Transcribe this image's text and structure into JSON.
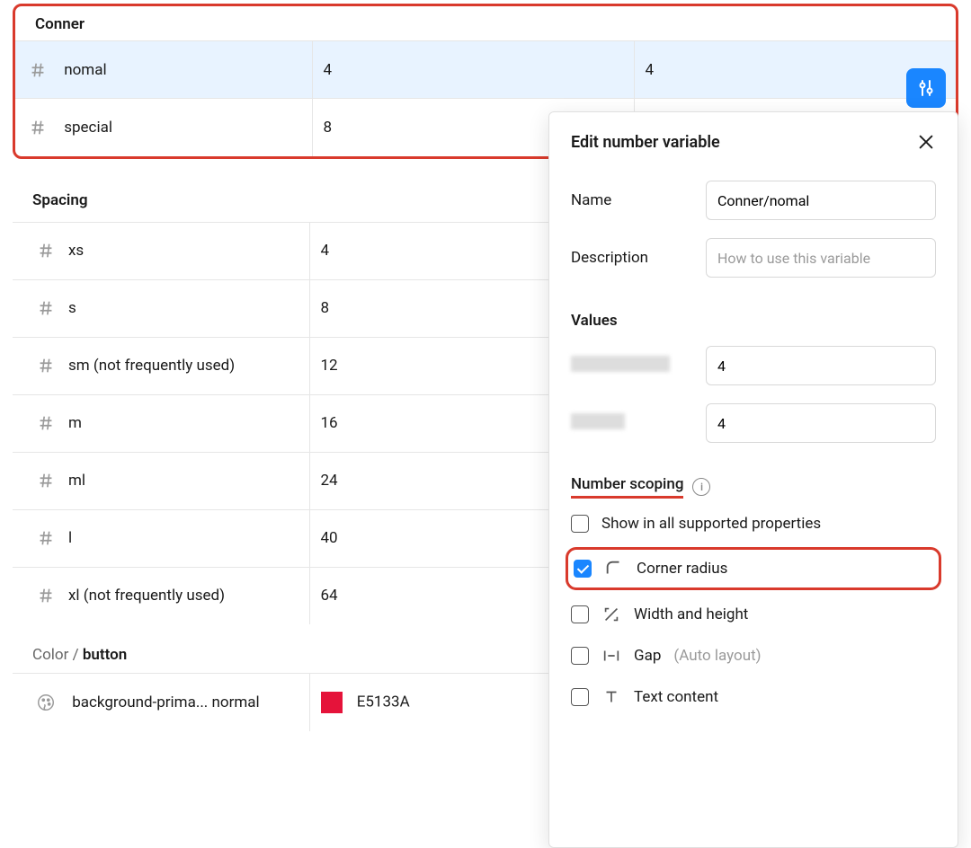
{
  "corner": {
    "heading": "Conner",
    "rows": [
      {
        "name": "nomal",
        "value1": "4",
        "value2": "4",
        "selected": true
      },
      {
        "name": "special",
        "value1": "8",
        "value2": ""
      }
    ]
  },
  "spacing": {
    "heading": "Spacing",
    "rows": [
      {
        "name": "xs",
        "value": "4"
      },
      {
        "name": "s",
        "value": "8"
      },
      {
        "name": "sm (not frequently used)",
        "value": "12"
      },
      {
        "name": "m",
        "value": "16"
      },
      {
        "name": "ml",
        "value": "24"
      },
      {
        "name": "l",
        "value": "40"
      },
      {
        "name": "xl (not frequently used)",
        "value": "64"
      }
    ]
  },
  "color": {
    "prefix": "Color /",
    "group": "button",
    "rows": [
      {
        "name": "background-prima... normal",
        "hex": "E5133A",
        "swatch": "#E5133A"
      }
    ]
  },
  "panel": {
    "title": "Edit number variable",
    "name_label": "Name",
    "name_value": "Conner/nomal",
    "desc_label": "Description",
    "desc_placeholder": "How to use this variable",
    "values_label": "Values",
    "v1": "4",
    "v2": "4",
    "scoping_label": "Number scoping",
    "scopes": {
      "all": "Show in all supported properties",
      "corner": "Corner radius",
      "wh": "Width and height",
      "gap_label": "Gap",
      "gap_hint": "(Auto layout)",
      "text": "Text content"
    }
  }
}
